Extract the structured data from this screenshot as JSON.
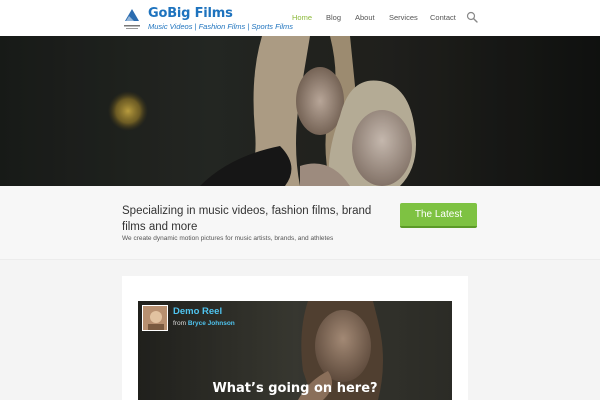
{
  "header": {
    "brand_title": "GoBig Films",
    "brand_tagline": "Music Videos | Fashion Films | Sports Films",
    "nav": [
      {
        "label": "Home",
        "active": true
      },
      {
        "label": "Blog",
        "active": false
      },
      {
        "label": "About",
        "active": false
      },
      {
        "label": "Services",
        "active": false
      },
      {
        "label": "Contact",
        "active": false
      }
    ],
    "search_icon": "search-icon"
  },
  "intro": {
    "headline": "Specializing in music videos, fashion films, brand films and more",
    "subtext": "We create dynamic motion pictures for music artists, brands, and athletes",
    "cta_label": "The Latest"
  },
  "video": {
    "title": "Demo Reel",
    "from_label": "from",
    "author": "Bryce Johnson",
    "caption": "What’s going on here?"
  },
  "colors": {
    "brand": "#1e73be",
    "accent": "#8cb93a",
    "cta": "#7ec242",
    "video_link": "#4fc3ee"
  }
}
